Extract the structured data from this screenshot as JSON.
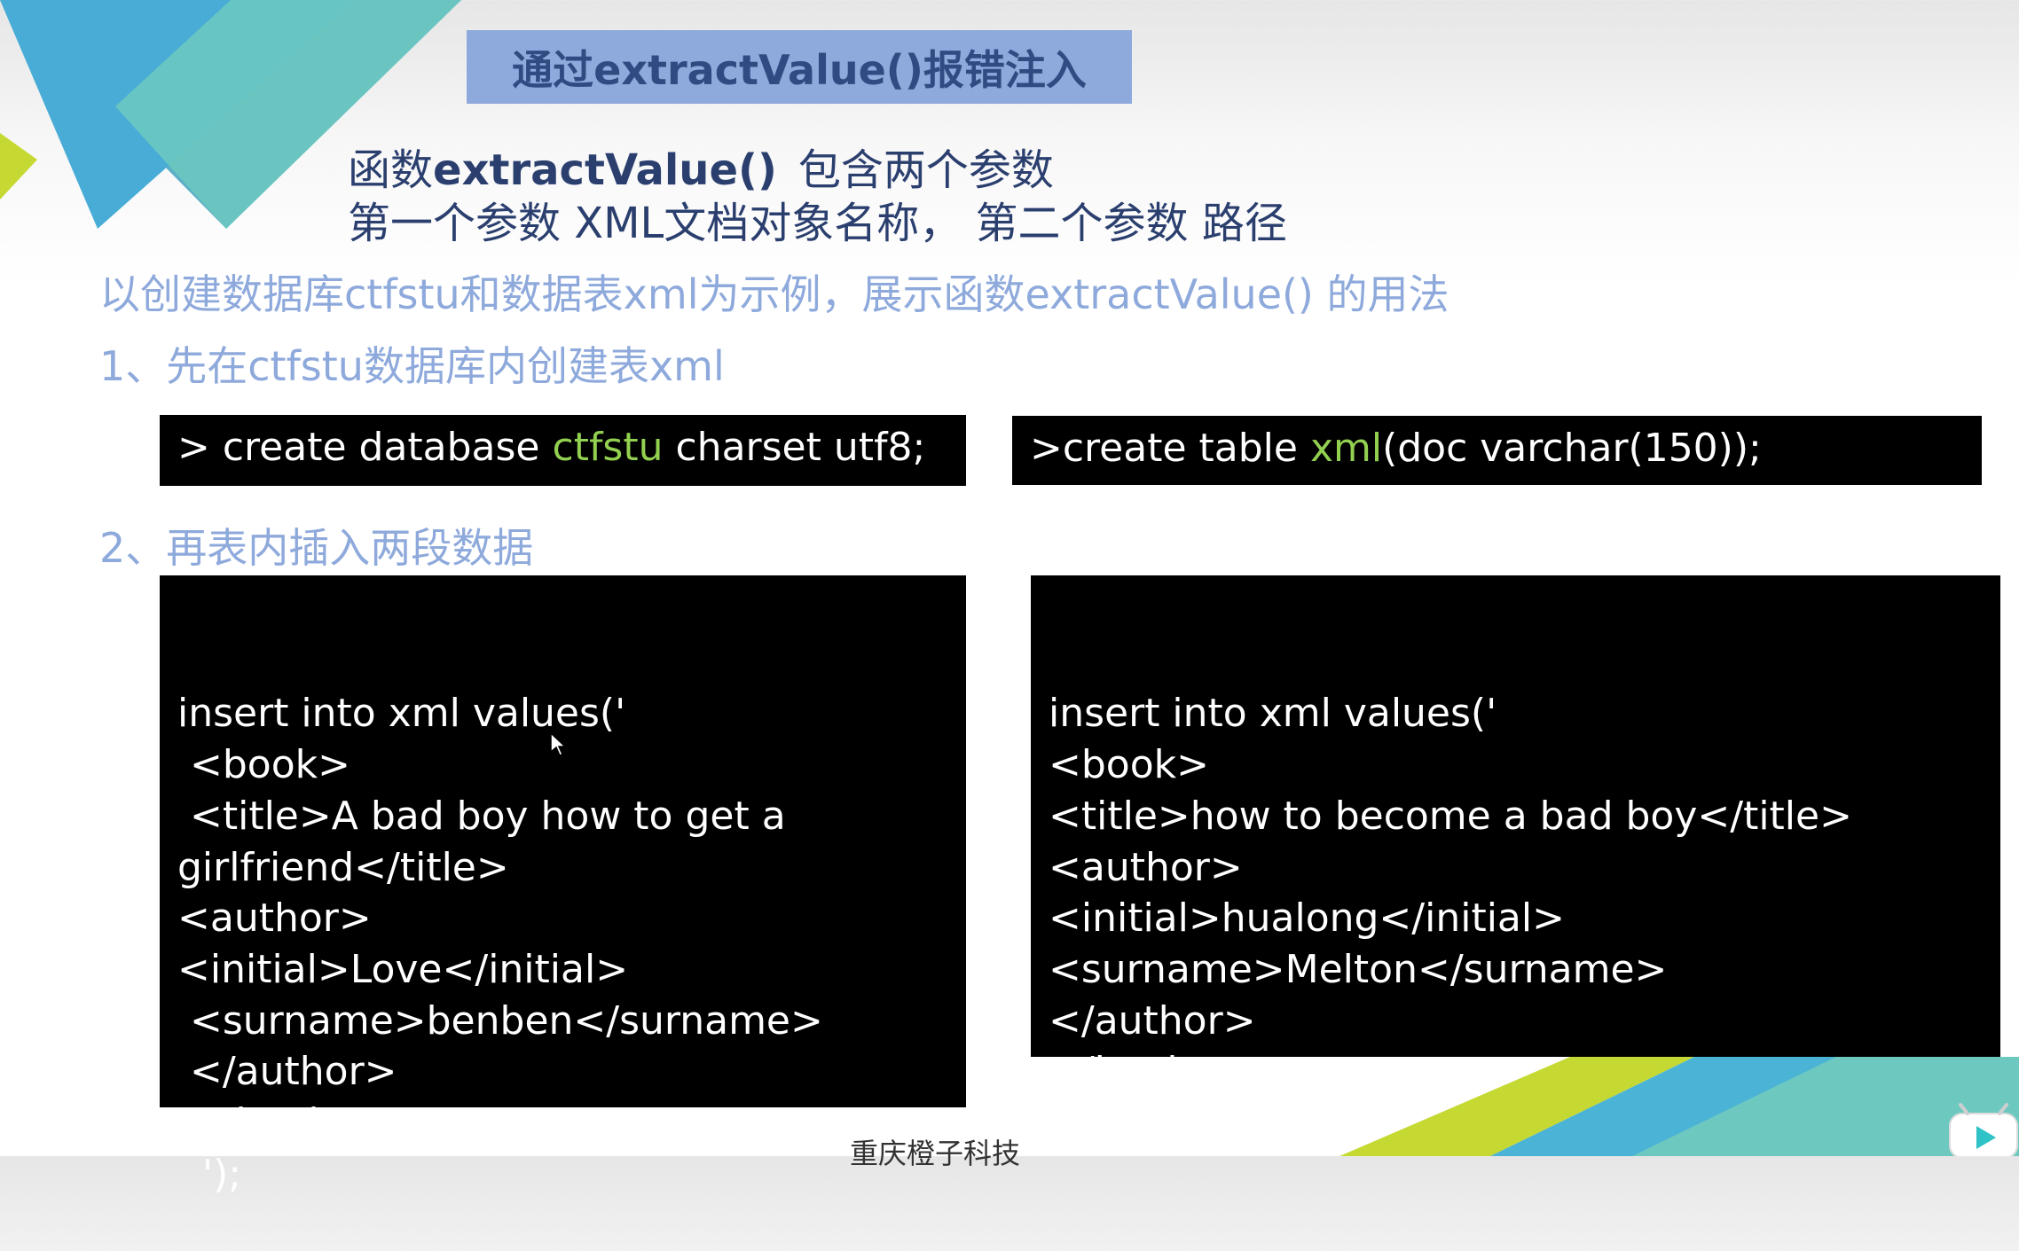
{
  "slide": {
    "title": "通过extractValue()报错注入",
    "intro": {
      "line1_a": "函数",
      "line1_b": "extractValue()",
      "line1_c": "包含两个参数",
      "line2": "第一个参数  XML文档对象名称，  第二个参数  路径"
    },
    "subheadings": {
      "example": "以创建数据库ctfstu和数据表xml为示例，展示函数extractValue()  的用法",
      "step1": "1、先在ctfstu数据库内创建表xml",
      "step2": "2、再表内插入两段数据"
    },
    "code1": {
      "a": "> create database ",
      "b": "ctfstu",
      "c": " charset utf8;"
    },
    "code2": {
      "a": ">create table ",
      "b": "xml",
      "c": "(doc varchar(150));"
    },
    "insert1": [
      "insert into xml values('",
      " <book>",
      " <title>A bad boy how to get a",
      "girlfriend</title>",
      "<author>",
      "<initial>Love</initial>",
      " <surname>benben</surname>",
      " </author>",
      " </book>",
      "  ');"
    ],
    "insert2": [
      "insert into xml values('",
      "<book>",
      "<title>how to become a bad boy</title>",
      "<author>",
      "<initial>hualong</initial>",
      "<surname>Melton</surname>",
      "</author>",
      "</book>",
      "');"
    ],
    "footer": "重庆橙子科技"
  },
  "colors": {
    "title_bg": "#8ea9db",
    "title_text": "#2f4b82",
    "subhead": "#8ea9db",
    "code_bg": "#000000",
    "code_highlight": "#92d050"
  }
}
